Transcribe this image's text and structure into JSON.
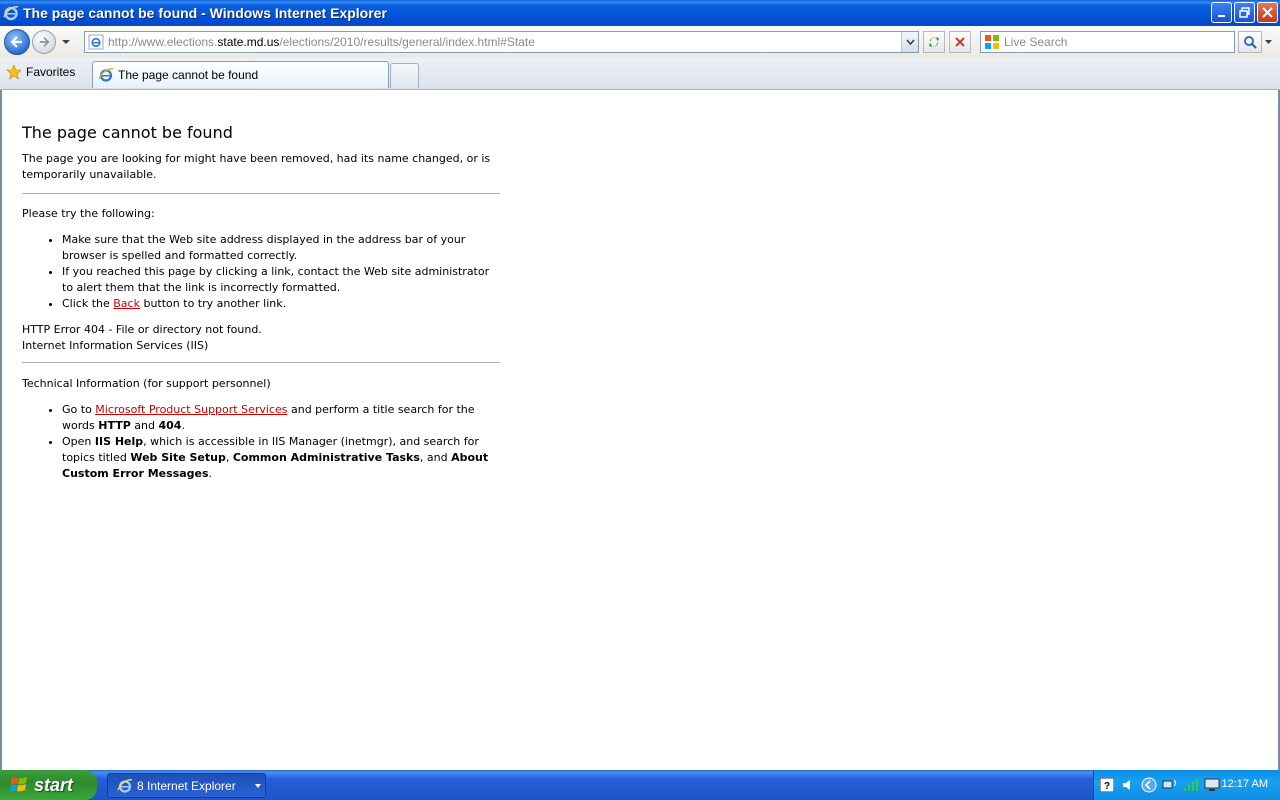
{
  "window": {
    "title": "The page cannot be found - Windows Internet Explorer"
  },
  "navbar": {
    "url_prefix": "http://www.elections.",
    "url_domain": "state.md.us",
    "url_suffix": "/elections/2010/results/general/index.html#State",
    "search_placeholder": "Live Search"
  },
  "tabbar": {
    "favorites_label": "Favorites",
    "tab_title": "The page cannot be found"
  },
  "page": {
    "heading": "The page cannot be found",
    "intro": "The page you are looking for might have been removed, had its name changed, or is temporarily unavailable.",
    "try_heading": "Please try the following:",
    "try_1": "Make sure that the Web site address displayed in the address bar of your browser is spelled and formatted correctly.",
    "try_2": "If you reached this page by clicking a link, contact the Web site administrator to alert them that the link is incorrectly formatted.",
    "try_3_before": "Click the ",
    "try_3_link": "Back",
    "try_3_after": " button to try another link.",
    "error_line": "HTTP Error 404 - File or directory not found.",
    "server_line": "Internet Information Services (IIS)",
    "tech_heading": "Technical Information (for support personnel)",
    "tech_1_before": "Go to ",
    "tech_1_link": "Microsoft Product Support Services",
    "tech_1_mid": " and perform a title search for the words ",
    "tech_1_b1": "HTTP",
    "tech_1_and": " and ",
    "tech_1_b2": "404",
    "tech_1_end": ".",
    "tech_2_before": "Open ",
    "tech_2_b1": "IIS Help",
    "tech_2_mid": ", which is accessible in IIS Manager (inetmgr), and search for topics titled ",
    "tech_2_b2": "Web Site Setup",
    "tech_2_comma": ", ",
    "tech_2_b3": "Common Administrative Tasks",
    "tech_2_and": ", and ",
    "tech_2_b4": "About Custom Error Messages",
    "tech_2_end": "."
  },
  "taskbar": {
    "start_label": "start",
    "task_label": "8 Internet Explorer",
    "clock": "12:17 AM"
  },
  "colors": {
    "titlebar_blue": "#0453d8",
    "link_red": "#cc0000",
    "start_green": "#3a9a3a",
    "tray_blue": "#0d8be3"
  }
}
